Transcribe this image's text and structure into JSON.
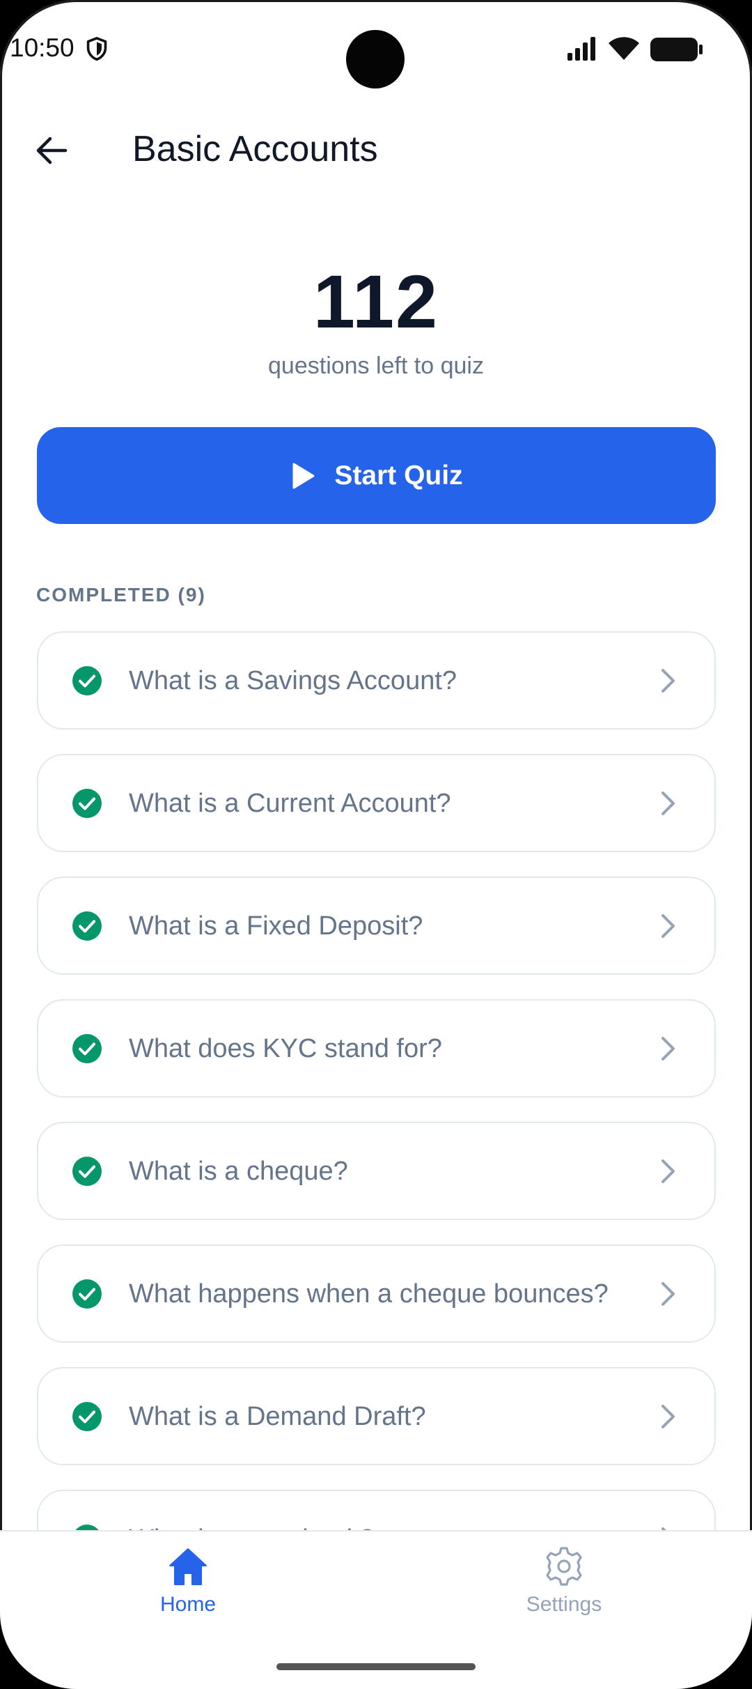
{
  "status_bar": {
    "time": "10:50"
  },
  "header": {
    "title": "Basic Accounts"
  },
  "counter": {
    "value": "112",
    "caption": "questions left to quiz"
  },
  "start_button": {
    "label": "Start Quiz"
  },
  "completed": {
    "heading": "COMPLETED (9)",
    "items": [
      {
        "label": "What is a Savings Account?"
      },
      {
        "label": "What is a Current Account?"
      },
      {
        "label": "What is a Fixed Deposit?"
      },
      {
        "label": "What does KYC stand for?"
      },
      {
        "label": "What is a cheque?"
      },
      {
        "label": "What happens when a cheque bounces?"
      },
      {
        "label": "What is a Demand Draft?"
      },
      {
        "label": "What is a passbook?"
      }
    ]
  },
  "bottom_nav": {
    "items": [
      {
        "label": "Home",
        "icon": "home-icon",
        "active": true
      },
      {
        "label": "Settings",
        "icon": "gear-icon",
        "active": false
      }
    ]
  },
  "colors": {
    "accent": "#2563eb",
    "success": "#059669",
    "muted": "#64748b"
  }
}
